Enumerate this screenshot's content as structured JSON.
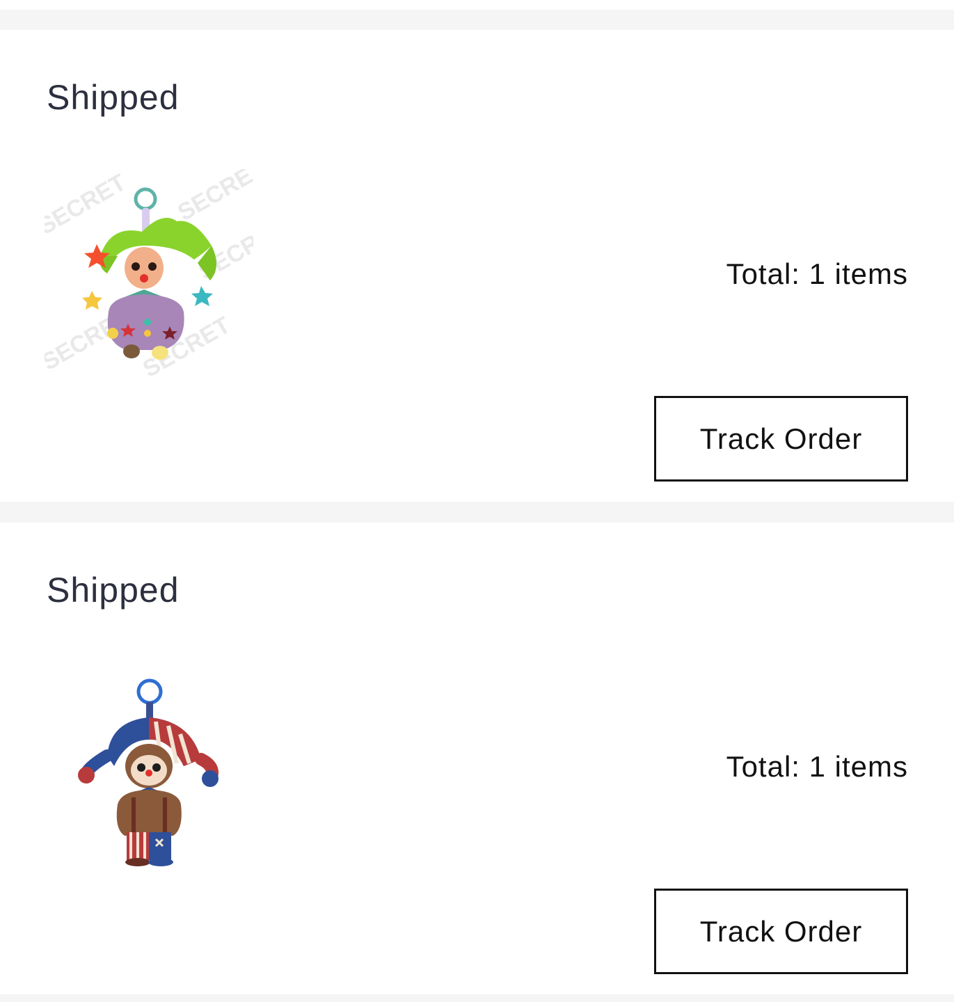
{
  "orders": [
    {
      "status": "Shipped",
      "product_image": "green-jester-plush-keychain",
      "watermark": "SECRET",
      "total": "Total: 1 items",
      "track_label": "Track Order"
    },
    {
      "status": "Shipped",
      "product_image": "labubu-jester-plush-keychain",
      "total": "Total: 1 items",
      "track_label": "Track Order"
    }
  ]
}
